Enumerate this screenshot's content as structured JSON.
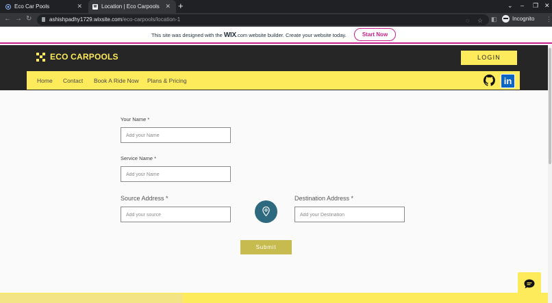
{
  "browser": {
    "tabs": [
      {
        "title": "Eco Car Pools"
      },
      {
        "title": "Location | Eco Carpools"
      }
    ],
    "url_host": "ashishpadhy1729.wixsite.com",
    "url_path": "/eco-carpools/location-1",
    "profile_label": "Incognito"
  },
  "wix_banner": {
    "text_before": "This site was designed with the ",
    "brand": "WIX",
    "text_after": ".com website builder. Create your website today.",
    "cta": "Start Now",
    "accent": "#c51f8a"
  },
  "site": {
    "logo_text": "ECO CARPOOLS",
    "login_label": "LOGIN",
    "nav": [
      {
        "label": "Home"
      },
      {
        "label": "Contact"
      },
      {
        "label": "Book A Ride Now"
      },
      {
        "label": "Plans & Pricing"
      }
    ],
    "social": {
      "github": "github-icon",
      "linkedin_text": "in"
    },
    "colors": {
      "brand_yellow": "#fdeb5c",
      "header_dark": "#262626",
      "pin_teal": "#2d6a80"
    }
  },
  "form": {
    "your_name": {
      "label": "Your Name *",
      "placeholder": "Add your Name",
      "value": ""
    },
    "service_name": {
      "label": "Service Name *",
      "placeholder": "Add your Name",
      "value": ""
    },
    "source": {
      "label": "Source Address *",
      "placeholder": "Add your source",
      "value": ""
    },
    "destination": {
      "label": "Destination Address *",
      "placeholder": "Add your Destination",
      "value": ""
    },
    "submit_label": "Submit"
  }
}
